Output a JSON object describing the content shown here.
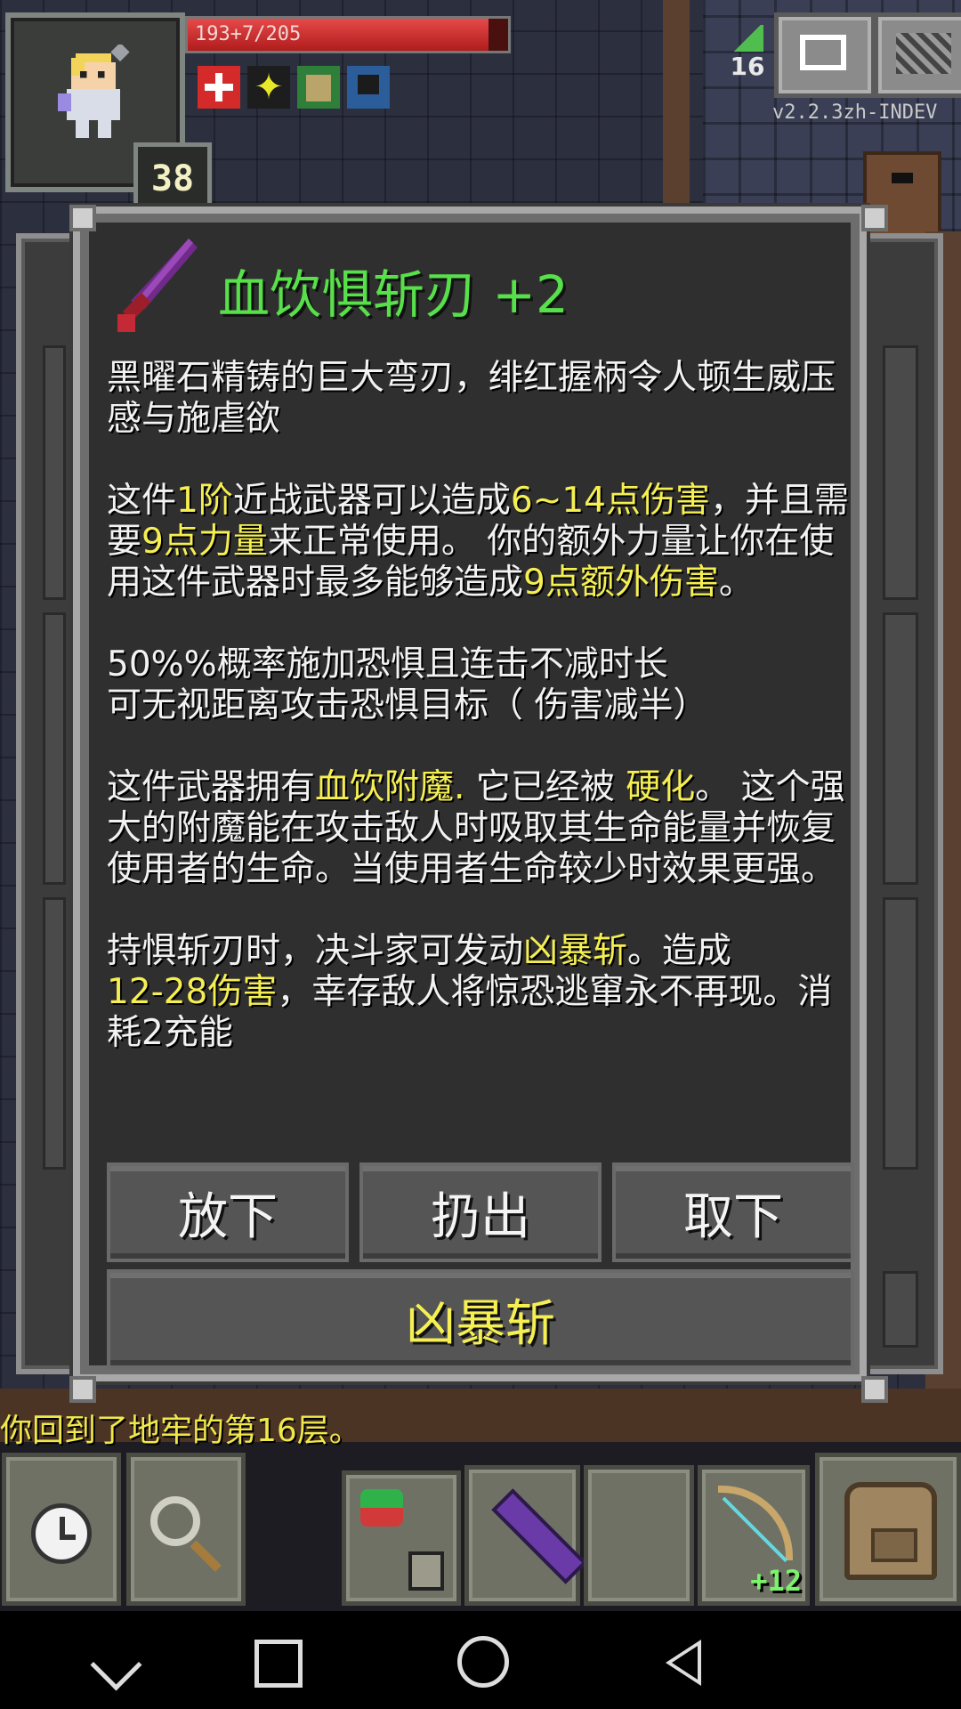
{
  "hud": {
    "hp_text": "193+7/205",
    "hp_fraction": 0.94,
    "level": "38",
    "depth": "16",
    "version": "v2.2.3zh-INDEV",
    "buffs": [
      "heal-icon",
      "haste-icon",
      "fortify-icon",
      "shield-icon"
    ]
  },
  "item": {
    "title": "血饮惧斩刃 +2",
    "desc_line1": "黑曜石精铸的巨大弯刃，绯红握柄令人顿生威压感与施虐欲",
    "p2_a": "这件",
    "p2_tier": "1阶",
    "p2_b": "近战武器可以造成",
    "p2_dmg": "6~14点伤害",
    "p2_c": "，并且需要",
    "p2_str": "9点力量",
    "p2_d": "来正常使用。 你的额外力量让你在使用这件武器时最多能够造成",
    "p2_bonus": "9点额外伤害",
    "p2_e": "。",
    "p3_line1": "50%%概率施加恐惧且连击不减时长",
    "p3_line2": "可无视距离攻击恐惧目标（ 伤害减半）",
    "p4_a": "这件武器拥有",
    "p4_ench": "血饮附魔.",
    "p4_b": " 它已经被 ",
    "p4_hard": "硬化",
    "p4_c": "。 这个强大的附魔能在攻击敌人时吸取其生命能量并恢复使用者的生命。当使用者生命较少时效果更强。",
    "p5_a": "持惧斩刃时，决斗家可发动",
    "p5_skill": "凶暴斩",
    "p5_b": "。造成",
    "p5_dmg": "12-28伤害",
    "p5_c": "，幸存敌人将惊恐逃窜永不再现。消耗2充能"
  },
  "actions": {
    "drop": "放下",
    "throw": "扔出",
    "unequip": "取下",
    "ability": "凶暴斩"
  },
  "log": {
    "message": "你回到了地牢的第16层。"
  },
  "toolbar": {
    "bow_level": "+12"
  },
  "colors": {
    "title_green": "#57e04a",
    "highlight_yellow": "#f5ef52",
    "hp_red": "#d63a3a"
  }
}
